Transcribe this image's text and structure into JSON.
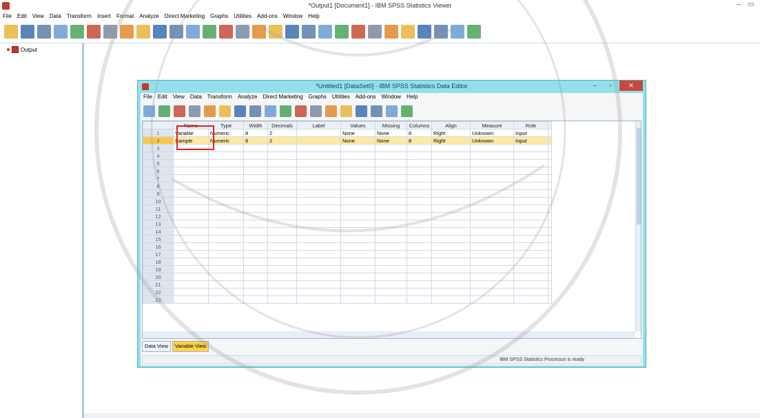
{
  "viewer": {
    "title": "*Output1 [Document1] - IBM SPSS Statistics Viewer",
    "window_controls": "– ▭",
    "menu": [
      "File",
      "Edit",
      "View",
      "Data",
      "Transform",
      "Insert",
      "Format",
      "Analyze",
      "Direct Marketing",
      "Graphs",
      "Utilities",
      "Add-ons",
      "Window",
      "Help"
    ],
    "toolbar_icons": [
      "open-icon",
      "save-icon",
      "print-icon",
      "print-preview-icon",
      "export-icon",
      "recall-dialog-icon",
      "undo-icon",
      "redo-icon",
      "goto-data-icon",
      "goto-case-icon",
      "goto-variable-icon",
      "variables-icon",
      "use-sets-icon",
      "show-all-icon",
      "value-labels-icon",
      "designate-window-icon",
      "select-last-output-icon",
      "insert-heading-icon",
      "insert-title-icon",
      "insert-text-icon",
      "promote-icon",
      "demote-icon",
      "expand-icon",
      "collapse-icon",
      "show-icon",
      "hide-icon",
      "insert-table-icon",
      "insert-chart-icon",
      "export-output-icon"
    ],
    "nav": {
      "label": "Output"
    }
  },
  "editor": {
    "title": "*Untitled1 [DataSet0] - IBM SPSS Statistics Data Editor",
    "menu": [
      "File",
      "Edit",
      "View",
      "Data",
      "Transform",
      "Analyze",
      "Direct Marketing",
      "Graphs",
      "Utilities",
      "Add-ons",
      "Window",
      "Help"
    ],
    "toolbar_icons": [
      "open-icon",
      "save-icon",
      "print-icon",
      "recall-dialog-icon",
      "undo-icon",
      "redo-icon",
      "goto-case-icon",
      "goto-variable-icon",
      "variables-icon",
      "find-icon",
      "insert-cases-icon",
      "insert-variable-icon",
      "split-file-icon",
      "weight-cases-icon",
      "select-cases-icon",
      "value-labels-icon",
      "use-sets-icon",
      "spell-icon"
    ],
    "columns": [
      "Name",
      "Type",
      "Width",
      "Decimals",
      "Label",
      "Values",
      "Missing",
      "Columns",
      "Align",
      "Measure",
      "Role"
    ],
    "rows": [
      {
        "num": "1",
        "cells": [
          "Variable",
          "Numeric",
          "8",
          "2",
          "",
          "None",
          "None",
          "8",
          "Right",
          "Unknown",
          "Input"
        ]
      },
      {
        "num": "2",
        "cells": [
          "Sample",
          "Numeric",
          "8",
          "2",
          "",
          "None",
          "None",
          "8",
          "Right",
          "Unknown",
          "Input"
        ]
      }
    ],
    "empty_row_numbers": [
      "3",
      "4",
      "5",
      "6",
      "7",
      "8",
      "9",
      "10",
      "11",
      "12",
      "13",
      "14",
      "15",
      "16",
      "17",
      "18",
      "19",
      "20",
      "21",
      "22",
      "23"
    ],
    "tabs": {
      "data_view": "Data View",
      "variable_view": "Variable View",
      "active": "Variable View"
    },
    "status": "IBM SPSS Statistics Processor is ready",
    "close_label": "✕",
    "min_label": "–",
    "max_label": "▫"
  },
  "colors": {
    "editor_title_bg": "#93e0ea",
    "selection_highlight": "#fde9a6",
    "active_tab": "#fbd249",
    "red_box": "#e02020"
  }
}
